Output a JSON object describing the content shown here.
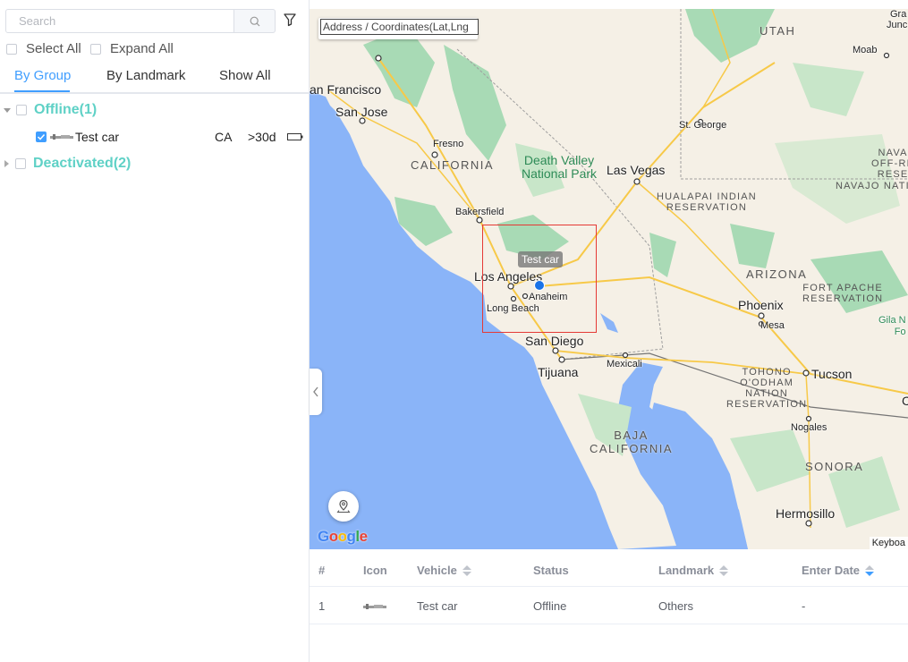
{
  "search": {
    "placeholder": "Search"
  },
  "options": {
    "select_all": "Select All",
    "expand_all": "Expand All"
  },
  "tabs": [
    {
      "label": "By Group",
      "active": true
    },
    {
      "label": "By Landmark",
      "active": false
    },
    {
      "label": "Show All",
      "active": false
    }
  ],
  "groups": [
    {
      "name": "Offline(1)",
      "expanded": true,
      "vehicles": [
        {
          "name": "Test car",
          "state": "CA",
          "age": ">30d",
          "checked": true
        }
      ]
    },
    {
      "name": "Deactivated(2)",
      "expanded": false,
      "vehicles": []
    }
  ],
  "map": {
    "address_placeholder": "Address / Coordinates(Lat,Lng",
    "vehicle_tag": "Test car",
    "attribution_logo": "Google",
    "keyboard_label": "Keyboa",
    "labels": {
      "utah": "UTAH",
      "moab": "Moab",
      "gra": "Gra",
      "junc": "Junc",
      "san_francisco": "an Francisco",
      "san_jose": "San Jose",
      "fresno": "Fresno",
      "california": "CALIFORNIA",
      "st_george": "St. George",
      "death_valley": "Death Valley\nNational Park",
      "las_vegas": "Las Vegas",
      "navajo": "NAVA\nOFF-RE\nRESE",
      "navajo_nat": "NAVAJO NATI",
      "hualapai": "HUALAPAI INDIAN\nRESERVATION",
      "bakersfield": "Bakersfield",
      "arizona": "ARIZONA",
      "los_angeles": "Los Angeles",
      "anaheim": "Anaheim",
      "long_beach": "Long Beach",
      "fort_apache": "FORT APACHE\nRESERVATION",
      "phoenix": "Phoenix",
      "mesa": "Mesa",
      "gila": "Gila N\nFo",
      "san_diego": "San Diego",
      "mexicali": "Mexicali",
      "tijuana": "Tijuana",
      "tohono": "TOHONO\nO'ODHAM\nNATION\nRESERVATION",
      "tucson": "Tucson",
      "nogales": "Nogales",
      "baja": "BAJA\nCALIFORNIA",
      "sonora": "SONORA",
      "hermosillo": "Hermosillo",
      "c_edge": "C"
    }
  },
  "table": {
    "headers": [
      "#",
      "Icon",
      "Vehicle",
      "Status",
      "Landmark",
      "Enter Date"
    ],
    "rows": [
      {
        "num": "1",
        "vehicle": "Test car",
        "status": "Offline",
        "landmark": "Others",
        "enter_date": "-"
      }
    ]
  },
  "colors": {
    "accent": "#409eff",
    "group": "#5fd1c6",
    "water": "#8ab4f8",
    "land": "#f5f0e6",
    "green": "#a8dab5"
  }
}
